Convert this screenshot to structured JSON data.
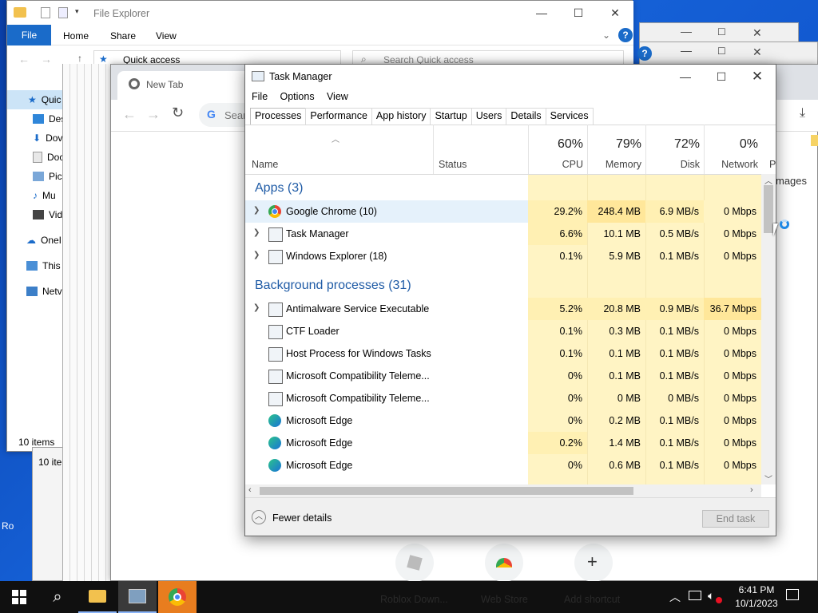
{
  "desktop": {
    "left_label": "Ro"
  },
  "file_explorer": {
    "title": "File Explorer",
    "ribbon_tabs": [
      "File",
      "Home",
      "Share",
      "View"
    ],
    "address": "Quick access",
    "search_placeholder": "Search Quick access",
    "nav": [
      "Quic",
      "Des",
      "Dov",
      "Doc",
      "Pict",
      "Mu",
      "Vid",
      "OneI",
      "This",
      "Netv"
    ],
    "status": "10 items",
    "status2": "10 iter"
  },
  "chrome": {
    "tab_title": "New Tab",
    "search_partial": "Sear",
    "images_link": "mages",
    "shortcuts": [
      "Roblox Down...",
      "Web Store",
      "Add shortcut"
    ]
  },
  "task_manager": {
    "title": "Task Manager",
    "menu": [
      "File",
      "Options",
      "View"
    ],
    "tabs": [
      "Processes",
      "Performance",
      "App history",
      "Startup",
      "Users",
      "Details",
      "Services"
    ],
    "columns": {
      "name": "Name",
      "status": "Status",
      "cpu_pct": "60%",
      "cpu": "CPU",
      "mem_pct": "79%",
      "mem": "Memory",
      "disk_pct": "72%",
      "disk": "Disk",
      "net_pct": "0%",
      "net": "Network",
      "power_partial": "P"
    },
    "groups": {
      "apps": "Apps (3)",
      "background": "Background processes (31)"
    },
    "apps": [
      {
        "name": "Google Chrome (10)",
        "cpu": "29.2%",
        "mem": "248.4 MB",
        "disk": "6.9 MB/s",
        "net": "0 Mbps",
        "icon": "chrome-icon"
      },
      {
        "name": "Task Manager",
        "cpu": "6.6%",
        "mem": "10.1 MB",
        "disk": "0.5 MB/s",
        "net": "0 Mbps",
        "icon": "app-window-icon"
      },
      {
        "name": "Windows Explorer (18)",
        "cpu": "0.1%",
        "mem": "5.9 MB",
        "disk": "0.1 MB/s",
        "net": "0 Mbps",
        "icon": "app-window-icon"
      }
    ],
    "background": [
      {
        "name": "Antimalware Service Executable",
        "cpu": "5.2%",
        "mem": "20.8 MB",
        "disk": "0.9 MB/s",
        "net": "36.7 Mbps",
        "icon": "app-window-icon",
        "expand": true
      },
      {
        "name": "CTF Loader",
        "cpu": "0.1%",
        "mem": "0.3 MB",
        "disk": "0.1 MB/s",
        "net": "0 Mbps",
        "icon": "app-window-icon"
      },
      {
        "name": "Host Process for Windows Tasks",
        "cpu": "0.1%",
        "mem": "0.1 MB",
        "disk": "0.1 MB/s",
        "net": "0 Mbps",
        "icon": "app-window-icon"
      },
      {
        "name": "Microsoft Compatibility Teleme...",
        "cpu": "0%",
        "mem": "0.1 MB",
        "disk": "0.1 MB/s",
        "net": "0 Mbps",
        "icon": "app-window-icon"
      },
      {
        "name": "Microsoft Compatibility Teleme...",
        "cpu": "0%",
        "mem": "0 MB",
        "disk": "0 MB/s",
        "net": "0 Mbps",
        "icon": "app-window-icon"
      },
      {
        "name": "Microsoft Edge",
        "cpu": "0%",
        "mem": "0.2 MB",
        "disk": "0.1 MB/s",
        "net": "0 Mbps",
        "icon": "edge-icon"
      },
      {
        "name": "Microsoft Edge",
        "cpu": "0.2%",
        "mem": "1.4 MB",
        "disk": "0.1 MB/s",
        "net": "0 Mbps",
        "icon": "edge-icon"
      },
      {
        "name": "Microsoft Edge",
        "cpu": "0%",
        "mem": "0.6 MB",
        "disk": "0.1 MB/s",
        "net": "0 Mbps",
        "icon": "edge-icon"
      }
    ],
    "fewer_details": "Fewer details",
    "end_task": "End task"
  },
  "taskbar": {
    "time": "6:41 PM",
    "date": "10/1/2023"
  },
  "colors": {
    "accent": "#1a6bc9",
    "heat_high": "#ffe79a",
    "heat_low": "#fff4c4",
    "group_text": "#1f5ba6"
  }
}
